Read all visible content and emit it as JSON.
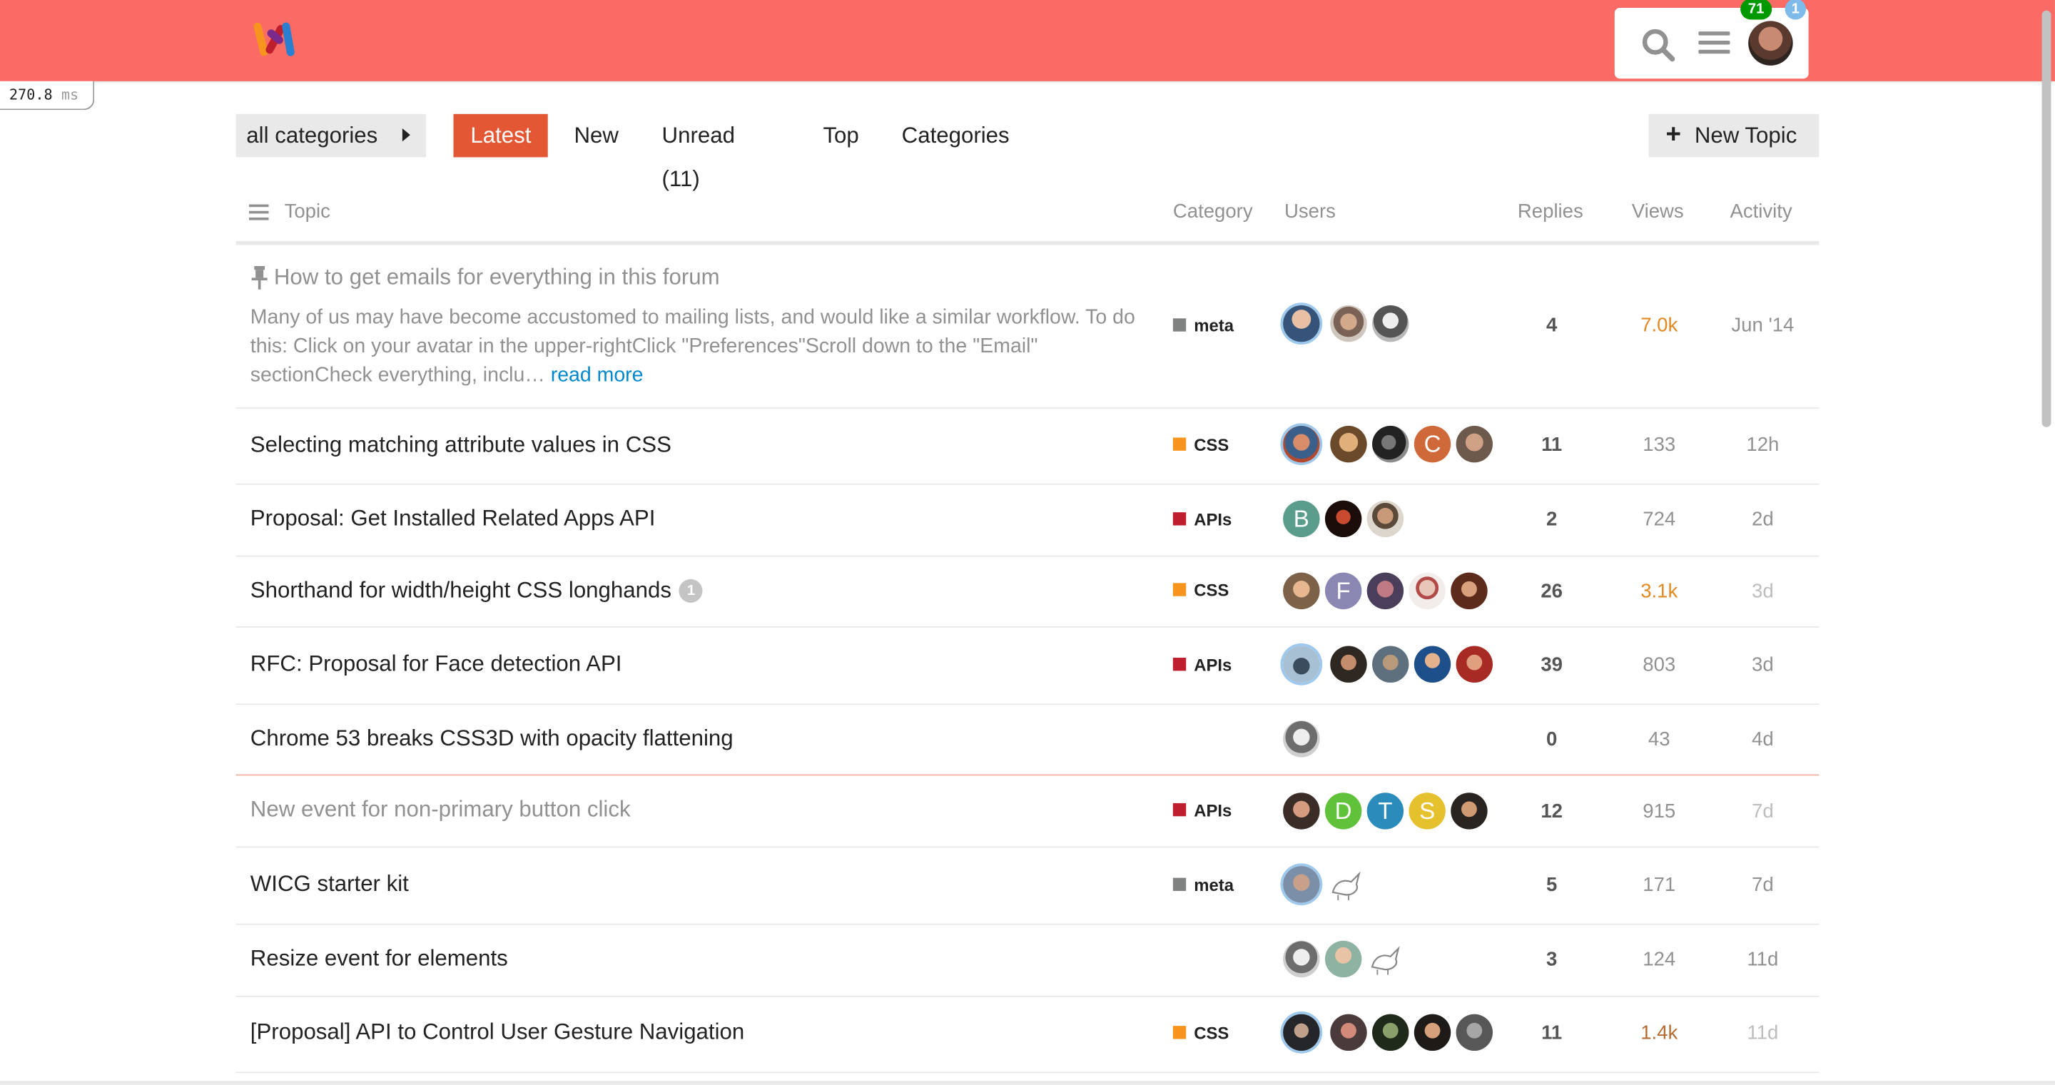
{
  "header": {
    "notifications_count": "71",
    "messages_count": "1",
    "brand_colors": [
      "#f96b64",
      "#e45735"
    ]
  },
  "timing": {
    "value": "270.8",
    "unit": "ms"
  },
  "nav": {
    "category_dropdown": "all categories",
    "tabs": [
      {
        "label": "Latest",
        "active": true
      },
      {
        "label": "New"
      },
      {
        "label": "Unread (11)"
      },
      {
        "label": "Top"
      },
      {
        "label": "Categories"
      }
    ],
    "new_topic": "New Topic"
  },
  "columns": {
    "topic": "Topic",
    "category": "Category",
    "users": "Users",
    "replies": "Replies",
    "views": "Views",
    "activity": "Activity"
  },
  "topics": [
    {
      "title": "How to get emails for everything in this forum",
      "pinned": true,
      "excerpt": "Many of us may have become accustomed to mailing lists, and would like a similar workflow. To do this: Click on your avatar in the upper-rightClick \"Preferences\"Scroll down to the \"Email\" sectionCheck everything, inclu…",
      "read_more": "read more",
      "category": "meta",
      "category_color": "#808281",
      "replies": "4",
      "views": "7.0k",
      "activity": "Jun '14"
    },
    {
      "title": "Selecting matching attribute values in CSS",
      "category": "CSS",
      "category_color": "#f7941d",
      "replies": "11",
      "views": "133",
      "activity": "12h"
    },
    {
      "title": "Proposal: Get Installed Related Apps API",
      "category": "APIs",
      "category_color": "#bf1e2e",
      "replies": "2",
      "views": "724",
      "activity": "2d"
    },
    {
      "title": "Shorthand for width/height CSS longhands",
      "post_count": "1",
      "category": "CSS",
      "category_color": "#f7941d",
      "replies": "26",
      "views": "3.1k",
      "activity": "3d"
    },
    {
      "title": "RFC: Proposal for Face detection API",
      "category": "APIs",
      "category_color": "#bf1e2e",
      "replies": "39",
      "views": "803",
      "activity": "3d"
    },
    {
      "title": "Chrome 53 breaks CSS3D with opacity flattening",
      "replies": "0",
      "views": "43",
      "activity": "4d"
    },
    {
      "title": "New event for non-primary button click",
      "category": "APIs",
      "category_color": "#bf1e2e",
      "replies": "12",
      "views": "915",
      "activity": "7d"
    },
    {
      "title": "WICG starter kit",
      "category": "meta",
      "category_color": "#808281",
      "replies": "5",
      "views": "171",
      "activity": "7d"
    },
    {
      "title": "Resize event for elements",
      "replies": "3",
      "views": "124",
      "activity": "11d"
    },
    {
      "title": "[Proposal] API to Control User Gesture Navigation",
      "category": "CSS",
      "category_color": "#f7941d",
      "replies": "11",
      "views": "1.4k",
      "activity": "11d"
    }
  ],
  "avatar_letters": {
    "b": "B",
    "c": "C",
    "f": "F",
    "d": "D",
    "t": "T",
    "s": "S"
  }
}
